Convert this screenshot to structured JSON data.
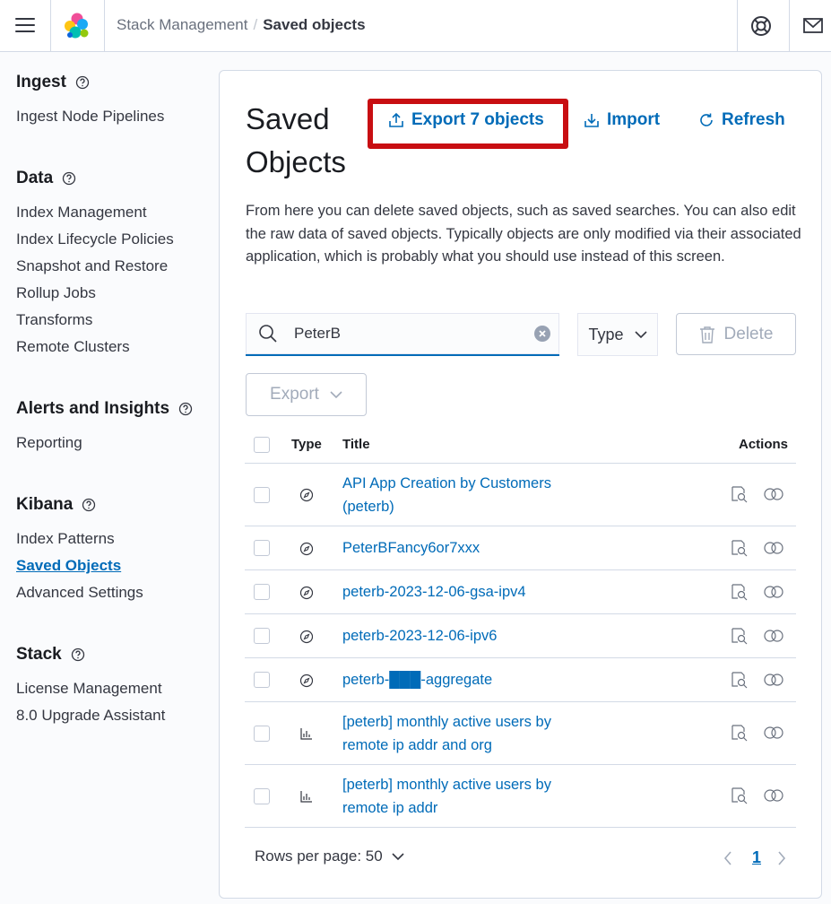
{
  "header": {
    "breadcrumb_parent": "Stack Management",
    "breadcrumb_separator": "/",
    "breadcrumb_current": "Saved objects"
  },
  "sidebar": {
    "groups": [
      {
        "title": "Ingest",
        "items": [
          "Ingest Node Pipelines"
        ]
      },
      {
        "title": "Data",
        "items": [
          "Index Management",
          "Index Lifecycle Policies",
          "Snapshot and Restore",
          "Rollup Jobs",
          "Transforms",
          "Remote Clusters"
        ]
      },
      {
        "title": "Alerts and Insights",
        "items": [
          "Reporting"
        ]
      },
      {
        "title": "Kibana",
        "items": [
          "Index Patterns",
          "Saved Objects",
          "Advanced Settings"
        ]
      },
      {
        "title": "Stack",
        "items": [
          "License Management",
          "8.0 Upgrade Assistant"
        ]
      }
    ],
    "active_item": "Saved Objects"
  },
  "main": {
    "title": "Saved Objects",
    "export_all_label": "Export 7 objects",
    "import_label": "Import",
    "refresh_label": "Refresh",
    "description": "From here you can delete saved objects, such as saved searches. You can also edit the raw data of saved objects. Typically objects are only modified via their associated application, which is probably what you should use instead of this screen.",
    "search_value": "PeterB",
    "type_filter_label": "Type",
    "delete_label": "Delete",
    "export_label": "Export"
  },
  "table": {
    "columns": {
      "type": "Type",
      "title": "Title",
      "actions": "Actions"
    },
    "rows": [
      {
        "type_icon": "compass-icon",
        "title": "API App Creation by Customers (peterb)"
      },
      {
        "type_icon": "compass-icon",
        "title": "PeterBFancy6or7xxx"
      },
      {
        "type_icon": "compass-icon",
        "title": "peterb-2023-12-06-gsa-ipv4"
      },
      {
        "type_icon": "compass-icon",
        "title": "peterb-2023-12-06-ipv6"
      },
      {
        "type_icon": "compass-icon",
        "title": "peterb-███-aggregate"
      },
      {
        "type_icon": "visualization-icon",
        "title": "[peterb] monthly active users by remote ip addr and org"
      },
      {
        "type_icon": "visualization-icon",
        "title": "[peterb] monthly active users by remote ip addr"
      }
    ]
  },
  "pagination": {
    "rows_per_page_label": "Rows per page: 50",
    "current_page": "1"
  },
  "colors": {
    "accent": "#006bb8",
    "highlight_box": "#c80e12",
    "border": "#d3dae6"
  }
}
